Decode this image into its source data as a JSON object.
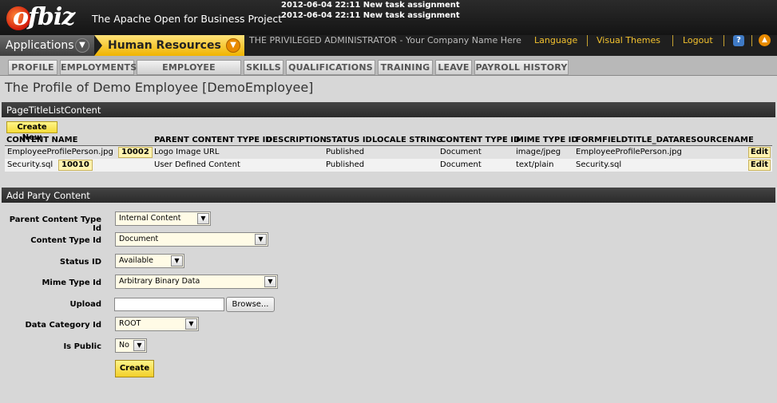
{
  "header": {
    "logo_text": "ofbiz",
    "tagline": "The Apache Open for Business Project",
    "notifications": [
      "2012-06-04 22:11 New task assignment",
      "2012-06-04 22:11 New task assignment"
    ]
  },
  "appbar": {
    "applications_label": "Applications",
    "current_app_label": "Human Resources",
    "user_line": "THE PRIVILEGED ADMINISTRATOR - Your Company Name Here",
    "links": [
      "Language",
      "Visual Themes",
      "Logout"
    ],
    "help_icon": "?",
    "collapse_icon": "▲"
  },
  "tabs": [
    "PROFILE",
    "EMPLOYMENTS",
    "EMPLOYEE POSITION",
    "SKILLS",
    "QUALIFICATIONS",
    "TRAINING",
    "LEAVE",
    "PAYROLL HISTORY"
  ],
  "page_title": "The Profile of Demo Employee [DemoEmployee]",
  "list": {
    "title": "PageTitleListContent",
    "create_new_label": "Create New",
    "columns": [
      "CONTENT NAME",
      "PARENT CONTENT TYPE ID",
      "DESCRIPTION",
      "STATUS ID",
      "LOCALE STRING",
      "CONTENT TYPE ID",
      "MIME TYPE ID",
      "FORMFIELDTITLE_DATARESOURCENAME"
    ],
    "rows": [
      {
        "content_name": "EmployeeProfilePerson.jpg",
        "id": "10002",
        "description": "Logo Image URL",
        "status": "Published",
        "content_type": "Document",
        "mime": "image/jpeg",
        "resource": "EmployeeProfilePerson.jpg",
        "edit_label": "Edit"
      },
      {
        "content_name": "Security.sql",
        "id": "10010",
        "description": "User Defined Content",
        "status": "Published",
        "content_type": "Document",
        "mime": "text/plain",
        "resource": "Security.sql",
        "edit_label": "Edit"
      }
    ]
  },
  "form": {
    "title": "Add Party Content",
    "labels": {
      "parent_content_type": "Parent Content Type Id",
      "content_type": "Content Type Id",
      "status": "Status ID",
      "mime_type": "Mime Type Id",
      "upload": "Upload",
      "data_category": "Data Category Id",
      "is_public": "Is Public"
    },
    "values": {
      "parent_content_type": "Internal Content",
      "content_type": "Document",
      "status": "Available",
      "mime_type": "Arbitrary Binary Data",
      "data_category": "ROOT",
      "is_public": "No"
    },
    "browse_label": "Browse...",
    "create_label": "Create"
  },
  "colors": {
    "accent_yellow": "#f2c12e",
    "header_bg": "#1f1f1f",
    "content_bg": "#d7d7d7"
  }
}
